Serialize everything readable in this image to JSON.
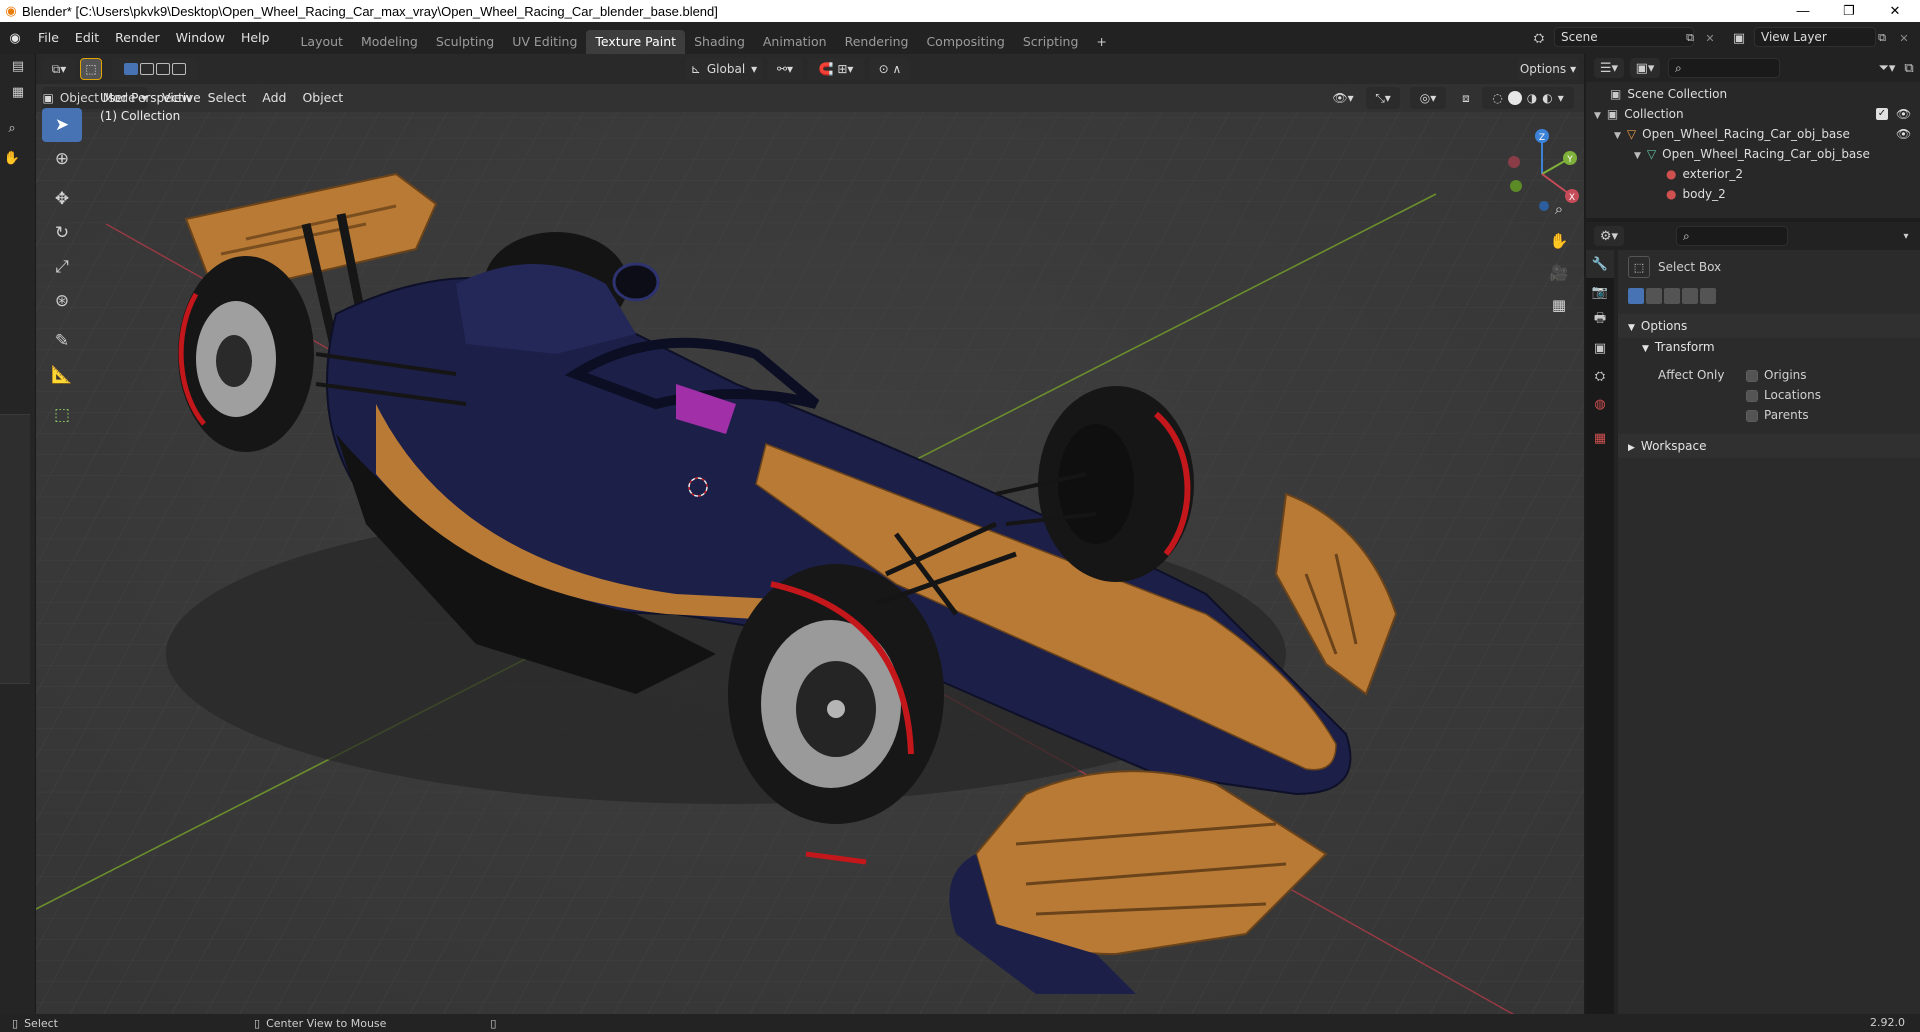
{
  "window": {
    "title": "Blender* [C:\\Users\\pkvk9\\Desktop\\Open_Wheel_Racing_Car_max_vray\\Open_Wheel_Racing_Car_blender_base.blend]",
    "minimize": "—",
    "maximize": "❐",
    "close": "✕"
  },
  "menu": {
    "items": [
      "File",
      "Edit",
      "Render",
      "Window",
      "Help"
    ]
  },
  "workspaces": [
    "Layout",
    "Modeling",
    "Sculpting",
    "UV Editing",
    "Texture Paint",
    "Shading",
    "Animation",
    "Rendering",
    "Compositing",
    "Scripting"
  ],
  "active_workspace": "Texture Paint",
  "add_workspace": "+",
  "scene": {
    "label": "Scene"
  },
  "view_layer": {
    "label": "View Layer"
  },
  "viewport": {
    "mode": "Object Mode",
    "menus": [
      "View",
      "Select",
      "Add",
      "Object"
    ],
    "orientation": "Global",
    "options": "Options",
    "overlay_title": "User Perspective",
    "overlay_collection": "(1) Collection",
    "gizmo_axes": [
      "Z",
      "Y",
      "X"
    ]
  },
  "outliner": {
    "scene_collection": "Scene Collection",
    "collection": "Collection",
    "object": "Open_Wheel_Racing_Car_obj_base",
    "mesh": "Open_Wheel_Racing_Car_obj_base",
    "materials": [
      "exterior_2",
      "body_2"
    ]
  },
  "properties": {
    "tool_name": "Select Box",
    "options_label": "Options",
    "transform_label": "Transform",
    "affect_only_label": "Affect Only",
    "affect_only": [
      "Origins",
      "Locations",
      "Parents"
    ],
    "workspace_label": "Workspace"
  },
  "statusbar": {
    "select": "Select",
    "center_view": "Center View to Mouse",
    "version": "2.92.0"
  },
  "colors": {
    "accent_blue": "#4772b3",
    "car_body": "#1c1f48",
    "car_accent": "#b87a35",
    "tire_stripe": "#c4171b",
    "axis_x": "#c44b57",
    "axis_y": "#7fb13a",
    "axis_z": "#3b82d8"
  }
}
